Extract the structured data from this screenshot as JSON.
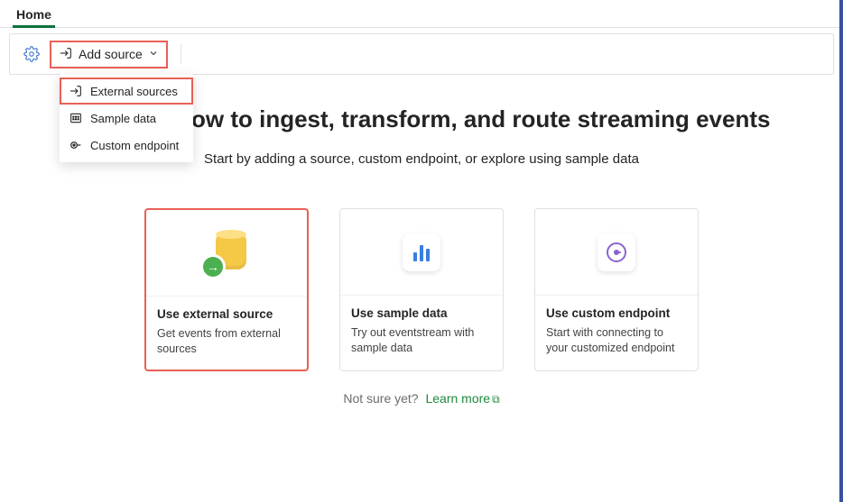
{
  "tabs": {
    "home": "Home"
  },
  "toolbar": {
    "add_source": "Add source"
  },
  "dropdown": {
    "external": "External sources",
    "sample": "Sample data",
    "custom": "Custom endpoint"
  },
  "hero": {
    "title": "Design a flow to ingest, transform, and route streaming events",
    "subtitle": "Start by adding a source, custom endpoint, or explore using sample data"
  },
  "cards": {
    "external": {
      "title": "Use external source",
      "desc": "Get events from external sources"
    },
    "sample": {
      "title": "Use sample data",
      "desc": "Try out eventstream with sample data"
    },
    "custom": {
      "title": "Use custom endpoint",
      "desc": "Start with connecting to your customized endpoint"
    }
  },
  "footer": {
    "not_sure": "Not sure yet?",
    "learn_more": "Learn more"
  },
  "colors": {
    "highlight": "#e86056",
    "brand_green": "#0f703b",
    "link_green": "#1f883d",
    "settings_blue": "#4a7bd6"
  }
}
